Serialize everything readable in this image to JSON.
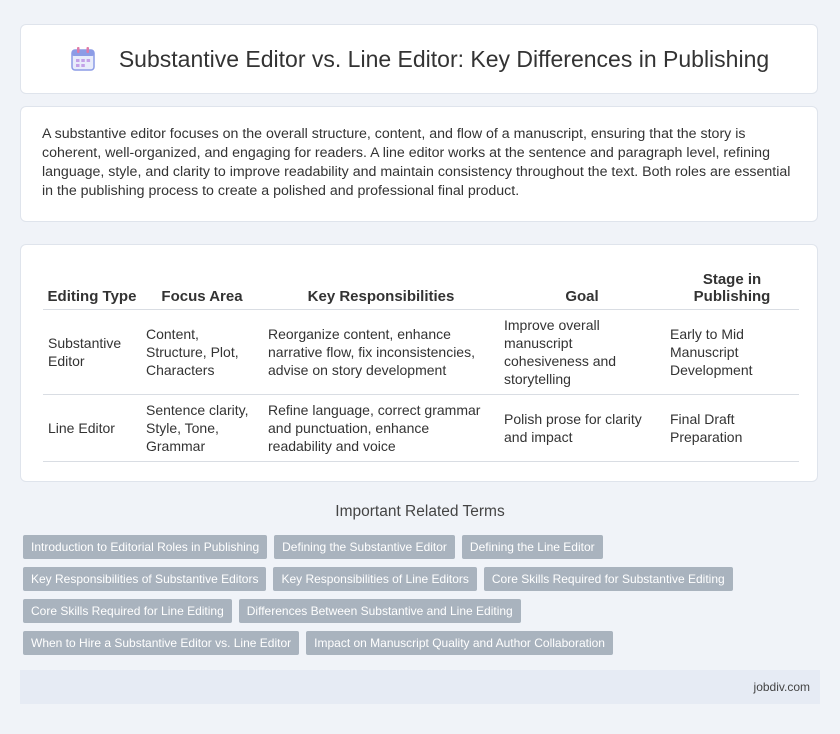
{
  "header": {
    "title": "Substantive Editor vs. Line Editor: Key Differences in Publishing",
    "icon": "calendar-icon",
    "accent": "#7b8fe0"
  },
  "intro": {
    "text": "A substantive editor focuses on the overall structure, content, and flow of a manuscript, ensuring that the story is coherent, well-organized, and engaging for readers. A line editor works at the sentence and paragraph level, refining language, style, and clarity to improve readability and maintain consistency throughout the text. Both roles are essential in the publishing process to create a polished and professional final product."
  },
  "table": {
    "headers": [
      "Editing Type",
      "Focus Area",
      "Key Responsibilities",
      "Goal",
      "Stage in Publishing"
    ],
    "rows": [
      [
        "Substantive Editor",
        "Content, Structure, Plot, Characters",
        "Reorganize content, enhance narrative flow, fix inconsistencies, advise on story development",
        "Improve overall manuscript cohesiveness and storytelling",
        "Early to Mid Manuscript Development"
      ],
      [
        "Line Editor",
        "Sentence clarity, Style, Tone, Grammar",
        "Refine language, correct grammar and punctuation, enhance readability and voice",
        "Polish prose for clarity and impact",
        "Final Draft Preparation"
      ]
    ]
  },
  "related": {
    "title": "Important Related Terms",
    "tags": [
      "Introduction to Editorial Roles in Publishing",
      "Defining the Substantive Editor",
      "Defining the Line Editor",
      "Key Responsibilities of Substantive Editors",
      "Key Responsibilities of Line Editors",
      "Core Skills Required for Substantive Editing",
      "Core Skills Required for Line Editing",
      "Differences Between Substantive and Line Editing",
      "When to Hire a Substantive Editor vs. Line Editor",
      "Impact on Manuscript Quality and Author Collaboration"
    ]
  },
  "footer": {
    "site": "jobdiv.com"
  }
}
